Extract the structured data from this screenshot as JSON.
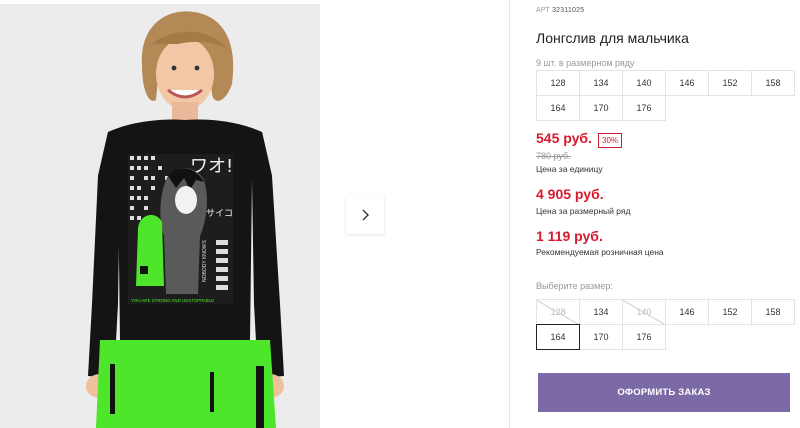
{
  "product": {
    "art_label": "АРТ",
    "art_number": "32311025",
    "title": "Лонгслив для мальчика",
    "range_note": "9 шт. в размерном ряду"
  },
  "size_range": [
    "128",
    "134",
    "140",
    "146",
    "152",
    "158",
    "164",
    "170",
    "176"
  ],
  "price": {
    "current": "545 руб.",
    "discount_badge": "30%",
    "old": "780 руб.",
    "unit_caption": "Цена за единицу",
    "range_total": "4 905 руб.",
    "range_caption": "Цена за размерный ряд",
    "retail": "1 119 руб.",
    "retail_caption": "Рекомендуемая розничная цена"
  },
  "size_select": {
    "label": "Выберите размер:",
    "options": [
      {
        "label": "128",
        "available": false
      },
      {
        "label": "134",
        "available": true
      },
      {
        "label": "140",
        "available": false
      },
      {
        "label": "146",
        "available": true
      },
      {
        "label": "152",
        "available": true
      },
      {
        "label": "158",
        "available": true
      },
      {
        "label": "164",
        "available": true,
        "selected": true
      },
      {
        "label": "170",
        "available": true
      },
      {
        "label": "176",
        "available": true
      }
    ]
  },
  "order_button_label": "ОФОРМИТЬ ЗАКАЗ",
  "shirt_print": {
    "katakana_title": "ワオ!",
    "katakana_side": "サイコ",
    "side_text": "NOBODY KNOWS",
    "slogan": "YOU ARE STRONG AND UNSTOPPABLE"
  },
  "icons": {
    "next": "chevron-right-icon"
  },
  "colors": {
    "price_red": "#d61a2f",
    "button_purple": "#7c6aa6",
    "shirt_black": "#141414",
    "accent_green": "#4ee62a"
  }
}
